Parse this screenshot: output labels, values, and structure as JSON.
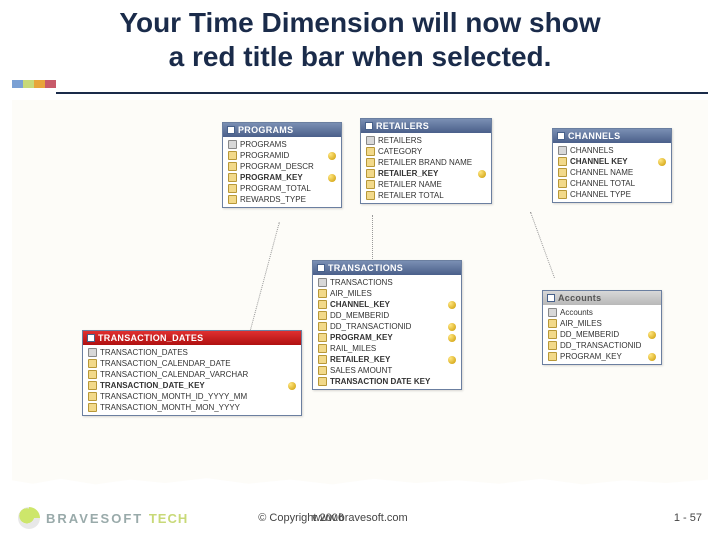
{
  "title_line1": "Your Time Dimension will now show",
  "title_line2": "a red title bar when selected.",
  "accent_colors": [
    "#7aa0d4",
    "#c8d978",
    "#e8a53a",
    "#c85a6a"
  ],
  "tables": {
    "programs": {
      "title": "PROGRAMS",
      "rows": [
        {
          "label": "PROGRAMS",
          "parent": true
        },
        {
          "label": "PROGRAMID",
          "key": true
        },
        {
          "label": "PROGRAM_DESCR"
        },
        {
          "label": "PROGRAM_KEY",
          "bold": true,
          "key": true
        },
        {
          "label": "PROGRAM_TOTAL"
        },
        {
          "label": "REWARDS_TYPE"
        }
      ]
    },
    "retailers": {
      "title": "RETAILERS",
      "rows": [
        {
          "label": "RETAILERS",
          "parent": true
        },
        {
          "label": "CATEGORY"
        },
        {
          "label": "RETAILER BRAND NAME"
        },
        {
          "label": "RETAILER_KEY",
          "bold": true,
          "key": true
        },
        {
          "label": "RETAILER NAME"
        },
        {
          "label": "RETAILER TOTAL"
        }
      ]
    },
    "channels": {
      "title": "CHANNELS",
      "rows": [
        {
          "label": "CHANNELS",
          "parent": true
        },
        {
          "label": "CHANNEL KEY",
          "bold": true,
          "key": true
        },
        {
          "label": "CHANNEL NAME"
        },
        {
          "label": "CHANNEL TOTAL"
        },
        {
          "label": "CHANNEL TYPE"
        }
      ]
    },
    "transactions": {
      "title": "TRANSACTIONS",
      "rows": [
        {
          "label": "TRANSACTIONS",
          "parent": true
        },
        {
          "label": "AIR_MILES"
        },
        {
          "label": "CHANNEL_KEY",
          "bold": true,
          "key": true
        },
        {
          "label": "DD_MEMBERID"
        },
        {
          "label": "DD_TRANSACTIONID",
          "key": true
        },
        {
          "label": "PROGRAM_KEY",
          "bold": true,
          "key": true
        },
        {
          "label": "RAIL_MILES"
        },
        {
          "label": "RETAILER_KEY",
          "bold": true,
          "key": true
        },
        {
          "label": "SALES AMOUNT"
        },
        {
          "label": "TRANSACTION DATE KEY",
          "bold": true
        }
      ]
    },
    "accounts": {
      "title": "Accounts",
      "rows": [
        {
          "label": "Accounts",
          "parent": true
        },
        {
          "label": "AIR_MILES"
        },
        {
          "label": "DD_MEMBERID",
          "key": true
        },
        {
          "label": "DD_TRANSACTIONID"
        },
        {
          "label": "PROGRAM_KEY",
          "key": true
        }
      ]
    },
    "transaction_dates": {
      "title": "TRANSACTION_DATES",
      "rows": [
        {
          "label": "TRANSACTION_DATES",
          "parent": true
        },
        {
          "label": "TRANSACTION_CALENDAR_DATE"
        },
        {
          "label": "TRANSACTION_CALENDAR_VARCHAR"
        },
        {
          "label": "TRANSACTION_DATE_KEY",
          "bold": true,
          "key": true
        },
        {
          "label": "TRANSACTION_MONTH_ID_YYYY_MM"
        },
        {
          "label": "TRANSACTION_MONTH_MON_YYYY"
        }
      ]
    }
  },
  "footer": {
    "brand": "BRAVESOFT",
    "brand_suffix": "TECH",
    "copyright": "© Copyright 2006",
    "url": "www.bravesoft.com",
    "page": "1 - 57"
  }
}
